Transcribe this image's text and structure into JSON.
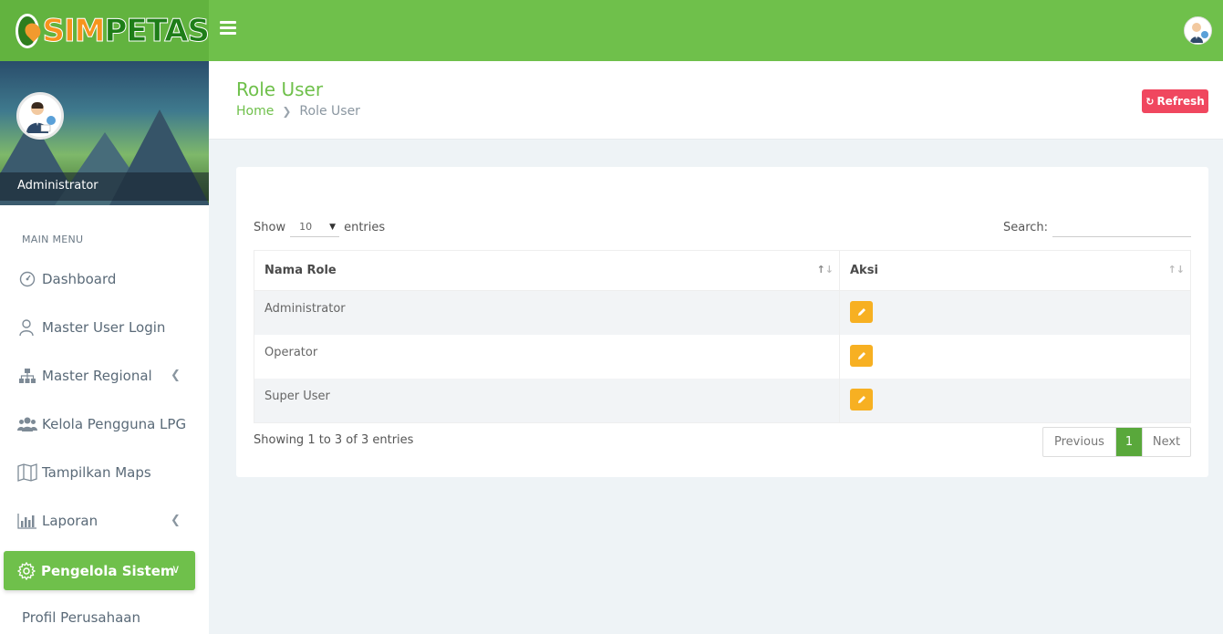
{
  "brand": {
    "part1": "SIM",
    "part2": "PETAS"
  },
  "sidebar": {
    "user_name": "Administrator",
    "menu_header": "MAIN MENU",
    "items": [
      {
        "label": "Dashboard",
        "icon": "dashboard-icon"
      },
      {
        "label": "Master User Login",
        "icon": "user-icon"
      },
      {
        "label": "Master Regional",
        "icon": "sitemap-icon",
        "has_chevron": true
      },
      {
        "label": "Kelola Pengguna LPG",
        "icon": "users-icon"
      },
      {
        "label": "Tampilkan Maps",
        "icon": "map-icon"
      },
      {
        "label": "Laporan",
        "icon": "bar-chart-icon",
        "has_chevron": true
      }
    ],
    "active_item": {
      "label": "Pengelola Sistem",
      "icon": "gear-icon"
    },
    "submenu_item": "Profil Perusahaan"
  },
  "header": {
    "title": "Role User",
    "breadcrumb": {
      "home": "Home",
      "current": "Role User"
    },
    "refresh_label": "Refresh"
  },
  "table_controls": {
    "show_label": "Show",
    "entries_label": "entries",
    "page_length": "10",
    "search_label": "Search:",
    "search_value": ""
  },
  "table": {
    "columns": [
      "Nama Role",
      "Aksi"
    ],
    "rows": [
      {
        "nama_role": "Administrator"
      },
      {
        "nama_role": "Operator"
      },
      {
        "nama_role": "Super User"
      }
    ]
  },
  "footer": {
    "info": "Showing 1 to 3 of 3 entries",
    "prev_label": "Previous",
    "page": "1",
    "next_label": "Next"
  },
  "colors": {
    "brand_green": "#6fc04b",
    "danger": "#f0475f",
    "warning": "#f7b022"
  }
}
